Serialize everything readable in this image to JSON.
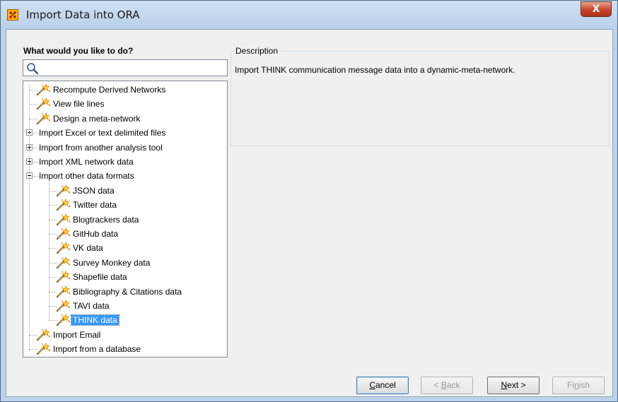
{
  "window": {
    "title": "Import Data into ORA",
    "close_label": "X"
  },
  "left_panel": {
    "label": "What would you like to do?",
    "search_placeholder": ""
  },
  "tree": {
    "items": [
      {
        "label": "Recompute Derived Networks",
        "type": "leaf",
        "icon": "magic-wand-icon"
      },
      {
        "label": "View file lines",
        "type": "leaf",
        "icon": "magic-wand-icon"
      },
      {
        "label": "Design a meta-network",
        "type": "leaf",
        "icon": "magic-wand-icon"
      },
      {
        "label": "Import Excel or text delimited files",
        "type": "folder",
        "state": "collapsed"
      },
      {
        "label": "Import from another analysis tool",
        "type": "folder",
        "state": "collapsed"
      },
      {
        "label": "Import XML network data",
        "type": "folder",
        "state": "collapsed"
      },
      {
        "label": "Import other data formats",
        "type": "folder",
        "state": "expanded"
      },
      {
        "label": "JSON data",
        "type": "leaf",
        "icon": "magic-wand-icon"
      },
      {
        "label": "Twitter data",
        "type": "leaf",
        "icon": "magic-wand-icon"
      },
      {
        "label": "Blogtrackers data",
        "type": "leaf",
        "icon": "magic-wand-icon"
      },
      {
        "label": "GitHub data",
        "type": "leaf",
        "icon": "magic-wand-icon"
      },
      {
        "label": "VK data",
        "type": "leaf",
        "icon": "magic-wand-icon"
      },
      {
        "label": "Survey Monkey data",
        "type": "leaf",
        "icon": "magic-wand-icon"
      },
      {
        "label": "Shapefile data",
        "type": "leaf",
        "icon": "magic-wand-icon"
      },
      {
        "label": "Bibliography & Citations data",
        "type": "leaf",
        "icon": "magic-wand-icon"
      },
      {
        "label": "TAVI data",
        "type": "leaf",
        "icon": "magic-wand-icon"
      },
      {
        "label": "THINK data",
        "type": "leaf",
        "icon": "magic-wand-icon",
        "selected": true
      },
      {
        "label": "Import Email",
        "type": "leaf",
        "icon": "magic-wand-icon"
      },
      {
        "label": "Import from a database",
        "type": "leaf",
        "icon": "magic-wand-icon"
      }
    ]
  },
  "description": {
    "label": "Description",
    "text": "Import THINK communication message data into a dynamic-meta-network."
  },
  "buttons": {
    "cancel": {
      "label": "Cancel",
      "mnemonic": "C",
      "rest": "ancel"
    },
    "back": {
      "label": "< Back",
      "pre": "< ",
      "mnemonic": "B",
      "rest": "ack"
    },
    "next": {
      "label": "Next >",
      "mnemonic": "N",
      "rest": "ext >"
    },
    "finish": {
      "label": "Finish",
      "pre": "Fi",
      "mnemonic": "n",
      "rest": "ish"
    }
  },
  "colors": {
    "selection": "#3399ff",
    "frame": "#bcd3ea",
    "close_button": "#c7432a"
  }
}
